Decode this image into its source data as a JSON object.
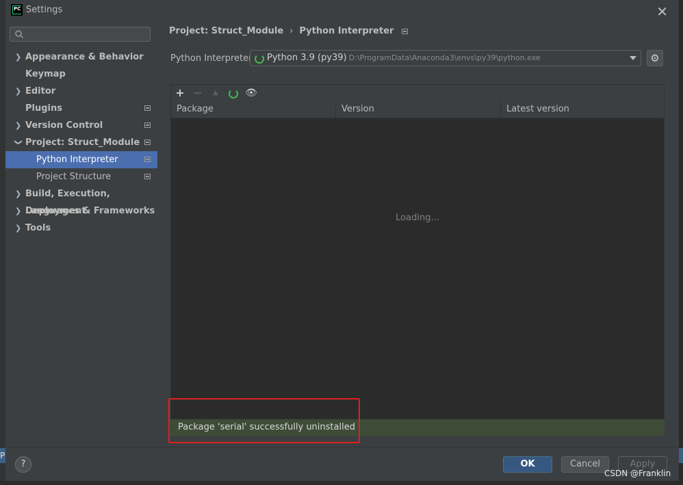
{
  "window": {
    "title": "Settings",
    "app_logo_text": "PC"
  },
  "sidebar": {
    "search_placeholder": "",
    "items": [
      {
        "label": "Appearance & Behavior",
        "expandable": true,
        "expanded": false,
        "bold": true
      },
      {
        "label": "Keymap",
        "expandable": false,
        "bold": true
      },
      {
        "label": "Editor",
        "expandable": true,
        "expanded": false,
        "bold": true
      },
      {
        "label": "Plugins",
        "expandable": false,
        "bold": true,
        "module_icon": true
      },
      {
        "label": "Version Control",
        "expandable": true,
        "expanded": false,
        "bold": true,
        "module_icon": true
      },
      {
        "label": "Project: Struct_Module",
        "expandable": true,
        "expanded": true,
        "bold": true,
        "module_icon": true
      },
      {
        "label": "Python Interpreter",
        "sub": true,
        "selected": true,
        "module_icon": true
      },
      {
        "label": "Project Structure",
        "sub": true,
        "module_icon": true
      },
      {
        "label": "Build, Execution, Deployment",
        "expandable": true,
        "expanded": false,
        "bold": true
      },
      {
        "label": "Languages & Frameworks",
        "expandable": true,
        "expanded": false,
        "bold": true
      },
      {
        "label": "Tools",
        "expandable": true,
        "expanded": false,
        "bold": true
      }
    ]
  },
  "breadcrumb": {
    "parent": "Project: Struct_Module",
    "current": "Python Interpreter"
  },
  "interpreter": {
    "label": "Python Interpreter:",
    "name": "Python 3.9 (py39)",
    "path": "D:\\ProgramData\\Anaconda3\\envs\\py39\\python.exe"
  },
  "packages": {
    "toolbar": {
      "add": "+",
      "remove": "−",
      "upgrade": "▲",
      "show_early": "👁"
    },
    "columns": [
      "Package",
      "Version",
      "Latest version"
    ],
    "loading_text": "Loading..."
  },
  "status": {
    "message": "Package 'serial' successfully uninstalled",
    "color": "#3d4b37"
  },
  "footer": {
    "help": "?",
    "ok": "OK",
    "cancel": "Cancel",
    "apply": "Apply"
  },
  "watermark": "CSDN @Franklin",
  "gutter_letter": "P",
  "colors": {
    "selection": "#4b6eaf",
    "ok_button": "#365880",
    "highlight_border": "#e02020",
    "spinner": "#3fb950"
  }
}
